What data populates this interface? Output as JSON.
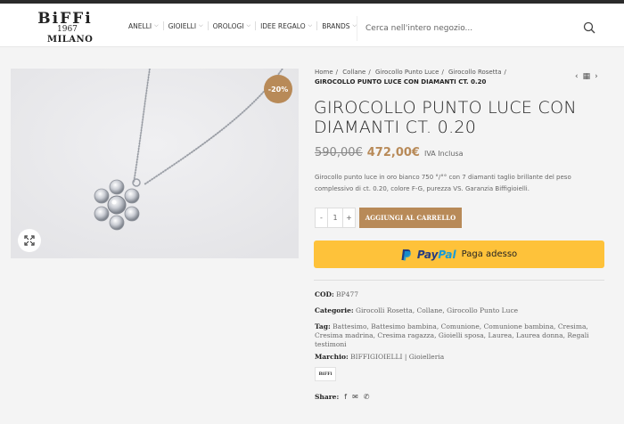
{
  "header": {
    "logo": {
      "line1": "BiFFi",
      "line2": "1967",
      "line3": "MILANO"
    },
    "nav": [
      {
        "label": "ANELLI"
      },
      {
        "label": "GIOIELLI"
      },
      {
        "label": "OROLOGI"
      },
      {
        "label": "IDEE REGALO"
      },
      {
        "label": "BRANDS"
      }
    ],
    "search": {
      "placeholder": "Cerca nell'intero negozio..."
    }
  },
  "product": {
    "badge": "-20%",
    "breadcrumb": [
      "Home",
      "Collane",
      "Girocollo Punto Luce",
      "Girocollo Rosetta"
    ],
    "breadcrumb_current": "GIROCOLLO PUNTO LUCE CON DIAMANTI CT. 0.20",
    "title": "GIROCOLLO PUNTO LUCE CON DIAMANTI CT. 0.20",
    "price_old": "590,00€",
    "price_new": "472,00€",
    "vat": "IVA Inclusa",
    "description": "Girocollo punto luce in oro bianco 750 °/°° con 7 diamanti taglio brillante del peso complessivo di ct. 0.20, colore F-G, purezza VS. Garanzia Biffigioielli.",
    "qty": {
      "minus": "-",
      "value": "1",
      "plus": "+"
    },
    "add_to_cart": "AGGIUNGI AL CARRELLO",
    "paypal": {
      "pay": "Pay",
      "pal": "Pal",
      "label": "Paga adesso"
    },
    "sku_label": "COD:",
    "sku": "BP477",
    "categories_label": "Categorie:",
    "categories": "Girocolli Rosetta, Collane, Girocollo Punto Luce",
    "tags_label": "Tag:",
    "tags": "Battesimo, Battesimo bambina, Comunione, Comunione bambina, Cresima, Cresima madrina, Cresima ragazza, Gioielli sposa, Laurea, Laurea donna, Regali testimoni",
    "brand_label": "Marchio:",
    "brand": "BIFFIGIOIELLI | Gioielleria",
    "brand_logo": "BiFFi",
    "share_label": "Share:"
  },
  "colors": {
    "accent": "#b88a58",
    "paypal_bg": "#fec23a",
    "topbar": "#2b2b2b"
  }
}
